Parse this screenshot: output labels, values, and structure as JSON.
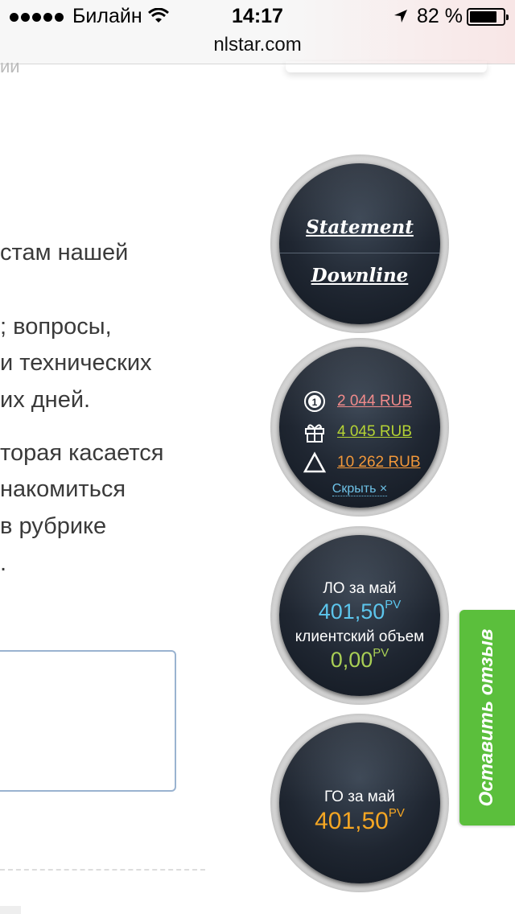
{
  "status_bar": {
    "carrier": "Билайн",
    "time": "14:17",
    "battery_percent": "82 %",
    "battery_level": 0.82
  },
  "browser": {
    "url": "nlstar.com"
  },
  "page": {
    "faded_top": "ий",
    "lines": [
      "стам нашей",
      "; вопросы,",
      "и технических",
      "их дней.",
      "торая касается",
      "накомиться",
      "в рубрике",
      "."
    ]
  },
  "widgets": {
    "links": {
      "statement": "Statement",
      "downline": "Downline"
    },
    "balances": [
      {
        "icon": "coin-one-icon",
        "value": "2 044 RUB",
        "color": "#f08a8a"
      },
      {
        "icon": "gift-icon",
        "value": "4 045 RUB",
        "color": "#b5d334"
      },
      {
        "icon": "triangle-icon",
        "value": "10 262 RUB",
        "color": "#f2983a"
      }
    ],
    "hide_label": "Скрыть ×",
    "lo": {
      "label": "ЛО за май",
      "value": "401,50",
      "unit": "PV",
      "color": "#5cc5ec",
      "client_label": "клиентский объем",
      "client_value": "0,00",
      "client_unit": "PV",
      "client_color": "#a9cf55"
    },
    "go": {
      "label": "ГО за май",
      "value": "401,50",
      "unit": "PV",
      "color": "#f5a623"
    }
  },
  "feedback_tab": {
    "label": "Оставить отзыв",
    "color": "#5bbf3c"
  }
}
